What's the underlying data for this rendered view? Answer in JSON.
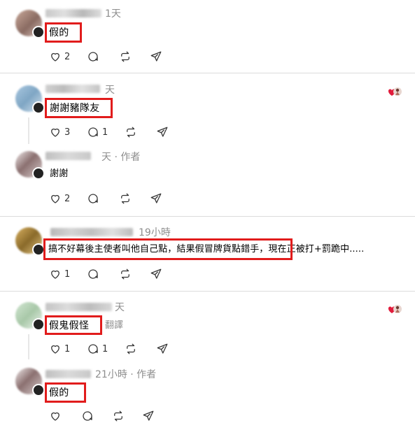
{
  "comments": [
    {
      "time": "1天",
      "text": "假的",
      "likes": "2",
      "replies": ""
    },
    {
      "time": "天",
      "text": "謝謝豬隊友",
      "likes": "3",
      "replies": "1"
    },
    {
      "time": "天 · 作者",
      "text": "謝謝",
      "likes": "2",
      "replies": ""
    },
    {
      "time": "19小時",
      "text": "搞不好幕後主使者叫他自己點，結果假冒牌貨點錯手，現在正被打+罰跪中.....",
      "likes": "1",
      "replies": ""
    },
    {
      "time": "天",
      "text": "假鬼假怪",
      "translate": "翻譯",
      "likes": "1",
      "replies": "1"
    },
    {
      "time": "21小時 · 作者",
      "text": "假的",
      "likes": "",
      "replies": ""
    }
  ],
  "icons": [
    "heart-icon",
    "comment-icon",
    "repost-icon",
    "share-icon"
  ],
  "colors": {
    "highlight": "#e11c1c",
    "muted": "#8e8e8e",
    "divider": "#dcdcdc"
  }
}
